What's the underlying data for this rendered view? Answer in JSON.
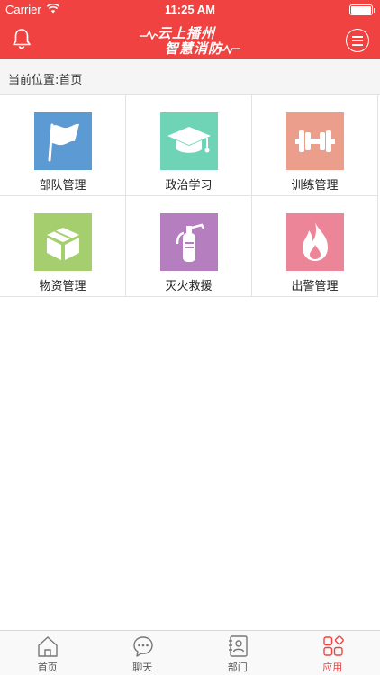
{
  "status_bar": {
    "carrier": "Carrier",
    "time": "11:25 AM"
  },
  "header": {
    "logo_line1": "云上播州",
    "logo_line2": "智慧消防",
    "accent_color": "#f04341"
  },
  "breadcrumb": {
    "text": "当前位置:首页"
  },
  "grid": {
    "items": [
      {
        "label": "部队管理",
        "icon": "flag-icon",
        "color": "#5b9ad2"
      },
      {
        "label": "政治学习",
        "icon": "graduation-cap-icon",
        "color": "#6fd4b5"
      },
      {
        "label": "训练管理",
        "icon": "dumbbell-icon",
        "color": "#ec9e8c"
      },
      {
        "label": "物资管理",
        "icon": "box-icon",
        "color": "#a5cf6e"
      },
      {
        "label": "灭火救援",
        "icon": "fire-extinguisher-icon",
        "color": "#b57fbf"
      },
      {
        "label": "出警管理",
        "icon": "flame-icon",
        "color": "#ec8598"
      }
    ]
  },
  "tabbar": {
    "tabs": [
      {
        "label": "首页",
        "icon": "home-icon"
      },
      {
        "label": "聊天",
        "icon": "chat-icon"
      },
      {
        "label": "部门",
        "icon": "contacts-icon"
      },
      {
        "label": "应用",
        "icon": "apps-icon",
        "active": true
      }
    ]
  }
}
